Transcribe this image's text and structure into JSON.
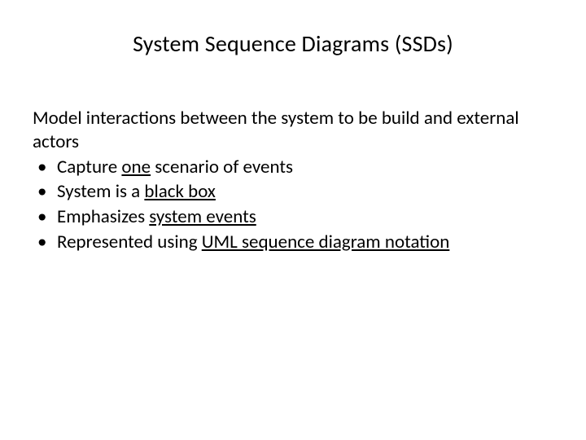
{
  "title": "System Sequence Diagrams (SSDs)",
  "intro": "Model interactions between the system to be build and external actors",
  "bullets": [
    {
      "pre": "Capture ",
      "u": "one",
      "post": " scenario of events"
    },
    {
      "pre": "System is a ",
      "u": "black box",
      "post": ""
    },
    {
      "pre": "Emphasizes ",
      "u": "system events",
      "post": ""
    },
    {
      "pre": "Represented using ",
      "u": "UML sequence diagram notation",
      "post": ""
    }
  ]
}
